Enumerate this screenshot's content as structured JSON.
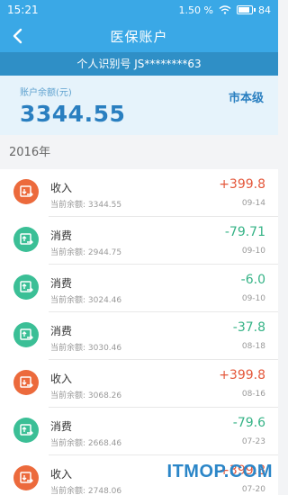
{
  "status_bar": {
    "time": "15:21",
    "data_speed": "1.50",
    "battery": "84"
  },
  "nav": {
    "title": "医保账户"
  },
  "id_bar": {
    "text": "个人识别号 JS********63"
  },
  "balance": {
    "label": "账户余额(元)",
    "value": "3344.55",
    "level": "市本级"
  },
  "year": "2016年",
  "transactions": [
    {
      "type": "收入",
      "kind": "income",
      "amount": "+399.8",
      "balance": "当前余额: 3344.55",
      "date": "09-14"
    },
    {
      "type": "消费",
      "kind": "expense",
      "amount": "-79.71",
      "balance": "当前余额: 2944.75",
      "date": "09-10"
    },
    {
      "type": "消费",
      "kind": "expense",
      "amount": "-6.0",
      "balance": "当前余额: 3024.46",
      "date": "09-10"
    },
    {
      "type": "消费",
      "kind": "expense",
      "amount": "-37.8",
      "balance": "当前余额: 3030.46",
      "date": "08-18"
    },
    {
      "type": "收入",
      "kind": "income",
      "amount": "+399.8",
      "balance": "当前余额: 3068.26",
      "date": "08-16"
    },
    {
      "type": "消费",
      "kind": "expense",
      "amount": "-79.6",
      "balance": "当前余额: 2668.46",
      "date": "07-23"
    },
    {
      "type": "收入",
      "kind": "income",
      "amount": "+399.8",
      "balance": "当前余额: 2748.06",
      "date": "07-20"
    }
  ],
  "icons": {
    "back": "chevron-left-icon",
    "income": "income-icon",
    "expense": "expense-icon"
  },
  "colors": {
    "primary": "#3aa8e6",
    "income": "#e4573a",
    "expense": "#35b386"
  },
  "watermark": "ITMOP.COM"
}
